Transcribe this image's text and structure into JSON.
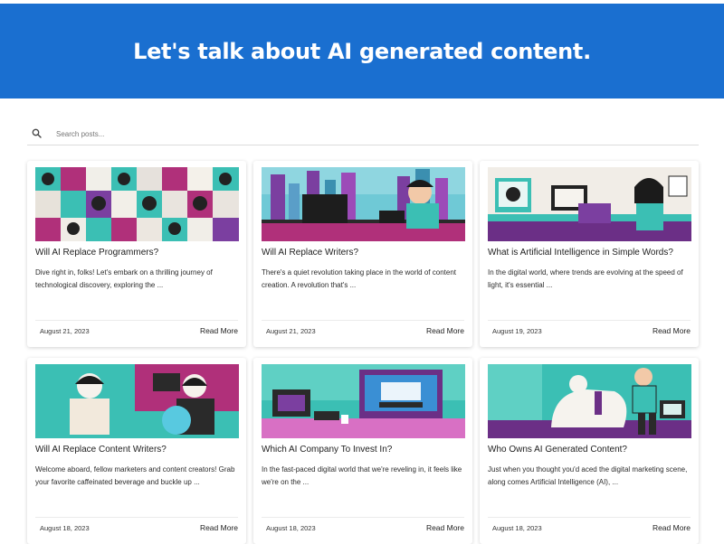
{
  "hero": {
    "title": "Let's talk about AI generated content."
  },
  "search": {
    "placeholder": "Search posts..."
  },
  "posts": [
    {
      "title": "Will AI Replace Programmers?",
      "excerpt": "Dive right in, folks! Let's embark on a thrilling journey of technological discovery, exploring the ...",
      "date": "August 21, 2023",
      "read_more": "Read More"
    },
    {
      "title": "Will AI Replace Writers?",
      "excerpt": "There's a quiet revolution taking place in the world of content creation. A revolution that's ...",
      "date": "August 21, 2023",
      "read_more": "Read More"
    },
    {
      "title": "What is Artificial Intelligence in Simple Words?",
      "excerpt": "In the digital world, where trends are evolving at the speed of light, it's essential ...",
      "date": "August 19, 2023",
      "read_more": "Read More"
    },
    {
      "title": "Will AI Replace Content Writers?",
      "excerpt": "Welcome aboard, fellow marketers and content creators! Grab your favorite caffeinated beverage and buckle up ...",
      "date": "August 18, 2023",
      "read_more": "Read More"
    },
    {
      "title": "Which AI Company To Invest In?",
      "excerpt": "In the fast-paced digital world that we're reveling in, it feels like we're on the ...",
      "date": "August 18, 2023",
      "read_more": "Read More"
    },
    {
      "title": "Who Owns AI Generated Content?",
      "excerpt": "Just when you thought you'd aced the digital marketing scene, along comes Artificial Intelligence (AI), ...",
      "date": "August 18, 2023",
      "read_more": "Read More"
    }
  ],
  "colors": {
    "hero_bg": "#1a6fd0",
    "illustration_teal": "#3bbfb4",
    "illustration_purple": "#7b3fa0",
    "illustration_magenta": "#b0307a"
  }
}
